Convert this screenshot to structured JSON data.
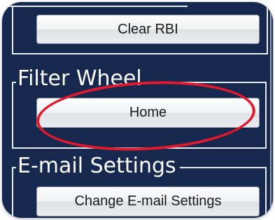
{
  "rbi": {
    "clear_label": "Clear RBI"
  },
  "filter_wheel": {
    "title": "Filter Wheel",
    "home_label": "Home"
  },
  "email_settings": {
    "title": "E-mail Settings",
    "change_label": "Change E-mail Settings"
  },
  "colors": {
    "panel_background": "#16284d",
    "divider": "#e8ecf2",
    "highlight_ring": "#e0192e",
    "button_face": "#eef0f3"
  }
}
